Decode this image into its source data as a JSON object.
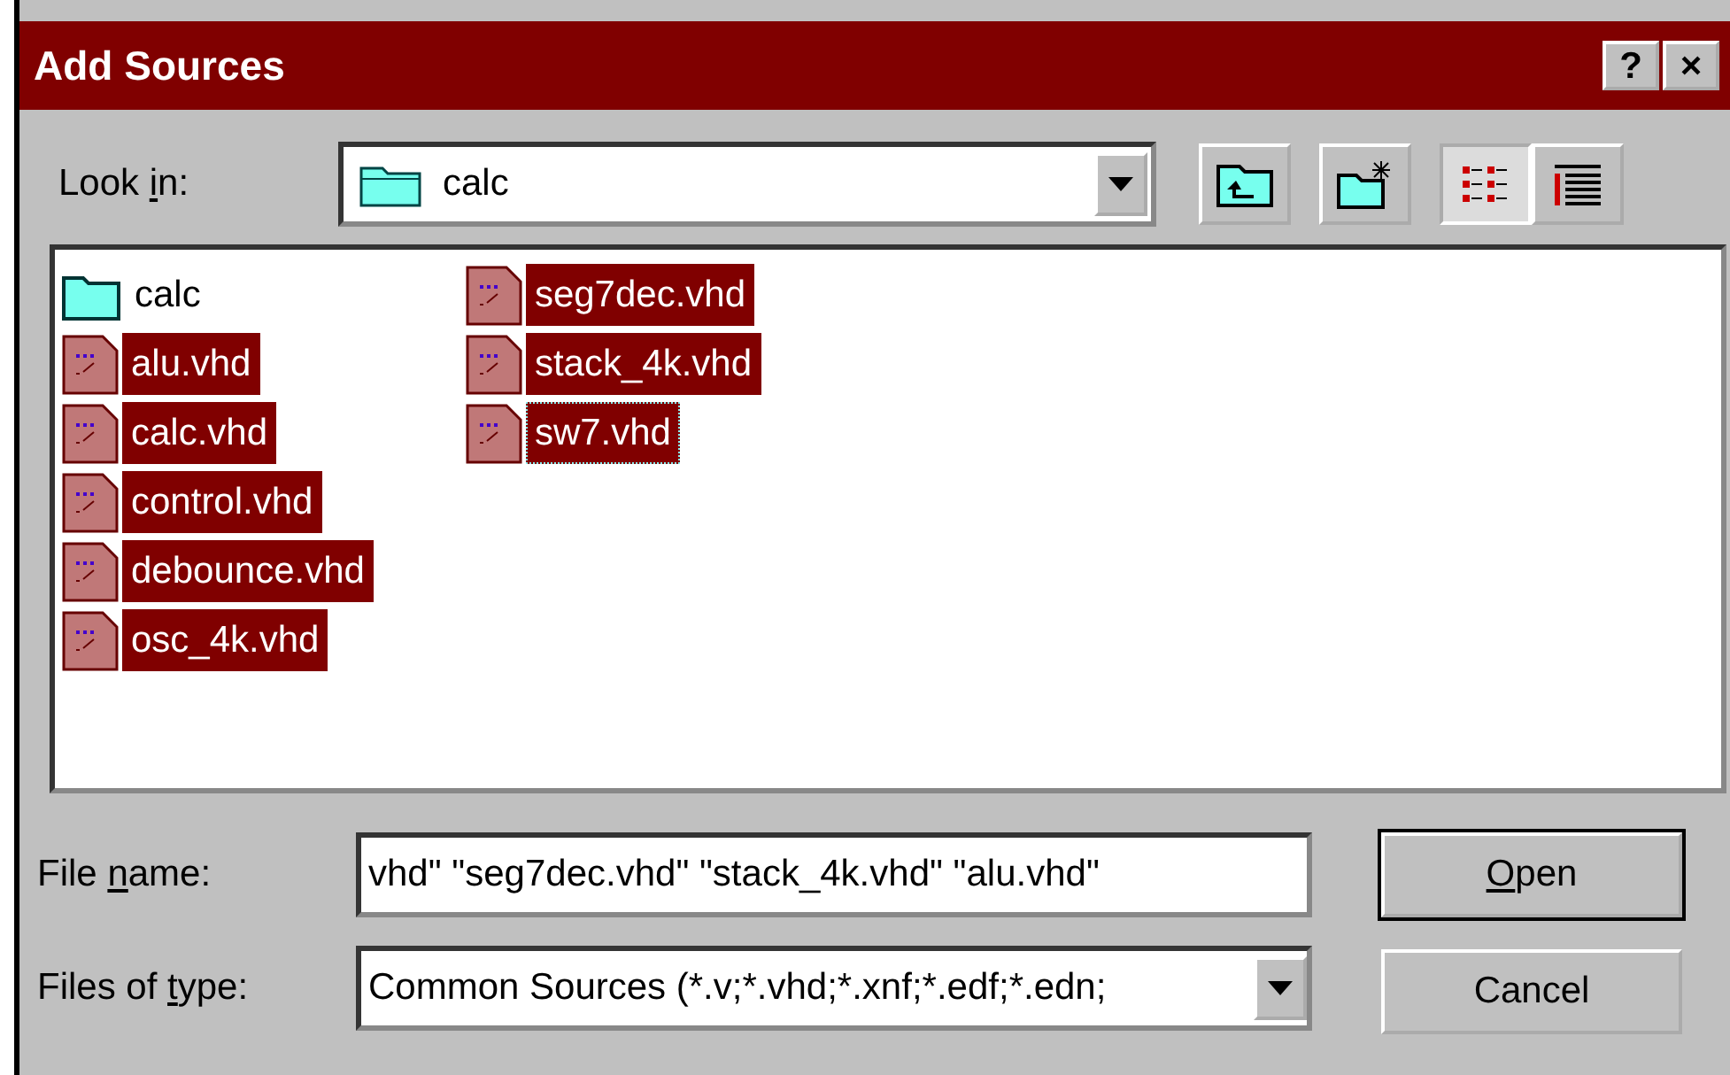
{
  "window": {
    "title": "Add Sources",
    "title_buttons": [
      "?",
      "×"
    ]
  },
  "look_in": {
    "label": {
      "before": "Look ",
      "mnemonic": "i",
      "after": "n:"
    },
    "value": "calc"
  },
  "files": [
    {
      "name": "calc",
      "kind": "folder",
      "selected": false,
      "focused": false
    },
    {
      "name": "alu.vhd",
      "kind": "file",
      "selected": true,
      "focused": false
    },
    {
      "name": "calc.vhd",
      "kind": "file",
      "selected": true,
      "focused": false
    },
    {
      "name": "control.vhd",
      "kind": "file",
      "selected": true,
      "focused": false
    },
    {
      "name": "debounce.vhd",
      "kind": "file",
      "selected": true,
      "focused": false
    },
    {
      "name": "osc_4k.vhd",
      "kind": "file",
      "selected": true,
      "focused": false
    },
    {
      "name": "seg7dec.vhd",
      "kind": "file",
      "selected": true,
      "focused": false
    },
    {
      "name": "stack_4k.vhd",
      "kind": "file",
      "selected": true,
      "focused": false
    },
    {
      "name": "sw7.vhd",
      "kind": "file",
      "selected": true,
      "focused": true
    }
  ],
  "file_name": {
    "label": {
      "before": "File ",
      "mnemonic": "n",
      "after": "ame:"
    },
    "value": "vhd\" \"seg7dec.vhd\" \"stack_4k.vhd\" \"alu.vhd\""
  },
  "file_type": {
    "label": {
      "before": "Files of ",
      "mnemonic": "t",
      "after": "ype:"
    },
    "value": "Common Sources (*.v;*.vhd;*.xnf;*.edf;*.edn;"
  },
  "buttons": [
    {
      "label": {
        "mnemonic": "O",
        "after": "pen"
      },
      "default": true
    },
    {
      "label": {
        "before": "Cancel"
      },
      "default": false
    }
  ]
}
